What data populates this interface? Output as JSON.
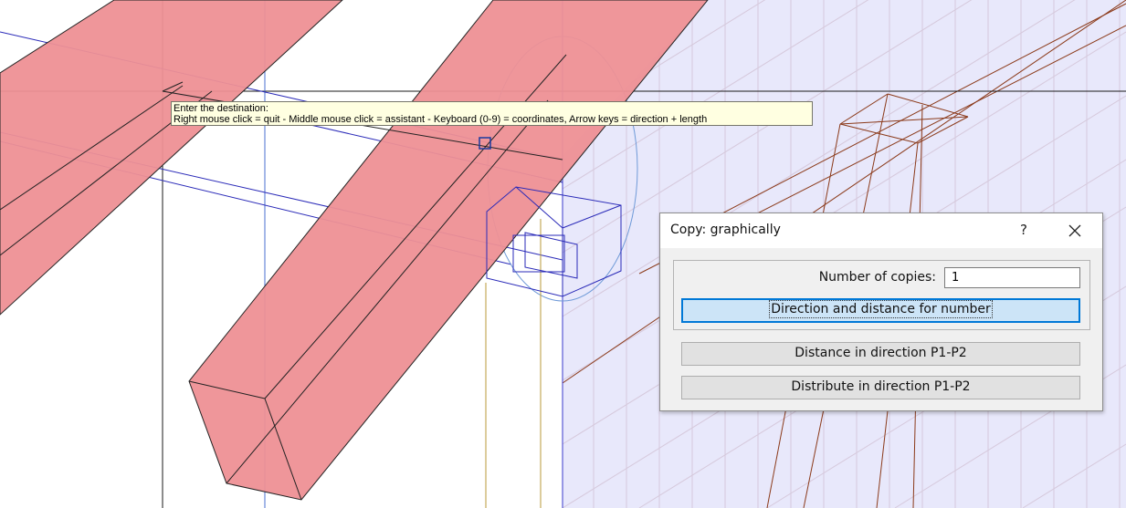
{
  "viewport": {
    "colors": {
      "beam_fill": "#ee9095",
      "panel_fill": "#e8e8fb",
      "grid_line": "#d8c8d8",
      "construction_line": "#3a3acc",
      "wire_brown": "#8b3a1a"
    }
  },
  "tooltip": {
    "line1": "Enter the destination:",
    "line2": "Right mouse click = quit - Middle mouse click = assistant - Keyboard (0-9) = coordinates, Arrow keys = direction + length"
  },
  "dialog": {
    "title": "Copy: graphically",
    "help_icon": "?",
    "close_icon": "close-icon",
    "copies_label": "Number of copies:",
    "copies_value": "1",
    "btn_direction": "Direction and distance for number",
    "btn_distance": "Distance in direction P1-P2",
    "btn_distribute": "Distribute in direction P1-P2"
  }
}
